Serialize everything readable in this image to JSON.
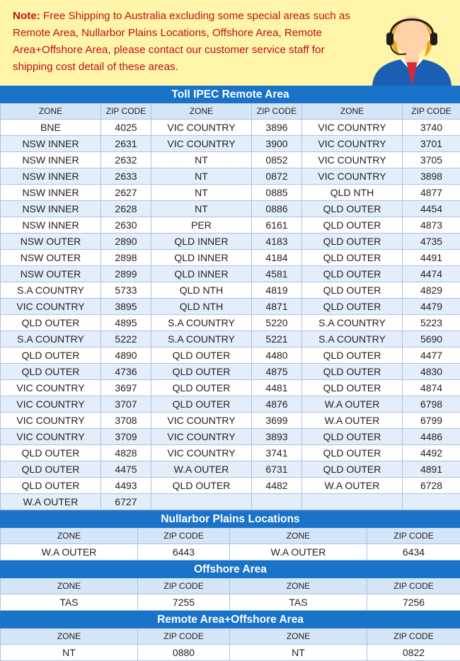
{
  "note": {
    "label": "Note:",
    "text": " Free Shipping to Australia excluding some special areas such as Remote Area, Nullarbor Plains Locations, Offshore Area, Remote Area+Offshore Area, please contact our customer service staff for shipping cost detail of these areas.",
    "agent_icon": "customer-service-agent-icon"
  },
  "colors": {
    "title_bg": "#1873c9",
    "header_bg": "#d4e5f7",
    "alt_row": "#e3eefa",
    "note_bg": "#fff5a8",
    "note_text": "#c00f14"
  },
  "toll": {
    "title": "Toll IPEC Remote Area",
    "headers": [
      "ZONE",
      "ZIP CODE",
      "ZONE",
      "ZIP CODE",
      "ZONE",
      "ZIP CODE"
    ],
    "rows": [
      [
        "BNE",
        "4025",
        "VIC COUNTRY",
        "3896",
        "VIC COUNTRY",
        "3740"
      ],
      [
        "NSW INNER",
        "2631",
        "VIC COUNTRY",
        "3900",
        "VIC COUNTRY",
        "3701"
      ],
      [
        "NSW INNER",
        "2632",
        "NT",
        "0852",
        "VIC COUNTRY",
        "3705"
      ],
      [
        "NSW INNER",
        "2633",
        "NT",
        "0872",
        "VIC COUNTRY",
        "3898"
      ],
      [
        "NSW INNER",
        "2627",
        "NT",
        "0885",
        "QLD NTH",
        "4877"
      ],
      [
        "NSW INNER",
        "2628",
        "NT",
        "0886",
        "QLD OUTER",
        "4454"
      ],
      [
        "NSW INNER",
        "2630",
        "PER",
        "6161",
        "QLD OUTER",
        "4873"
      ],
      [
        "NSW OUTER",
        "2890",
        "QLD INNER",
        "4183",
        "QLD OUTER",
        "4735"
      ],
      [
        "NSW OUTER",
        "2898",
        "QLD INNER",
        "4184",
        "QLD OUTER",
        "4491"
      ],
      [
        "NSW OUTER",
        "2899",
        "QLD INNER",
        "4581",
        "QLD OUTER",
        "4474"
      ],
      [
        "S.A COUNTRY",
        "5733",
        "QLD NTH",
        "4819",
        "QLD OUTER",
        "4829"
      ],
      [
        "VIC COUNTRY",
        "3895",
        "QLD NTH",
        "4871",
        "QLD OUTER",
        "4479"
      ],
      [
        "QLD OUTER",
        "4895",
        "S.A COUNTRY",
        "5220",
        "S.A COUNTRY",
        "5223"
      ],
      [
        "S.A COUNTRY",
        "5222",
        "S.A COUNTRY",
        "5221",
        "S.A COUNTRY",
        "5690"
      ],
      [
        "QLD OUTER",
        "4890",
        "QLD OUTER",
        "4480",
        "QLD OUTER",
        "4477"
      ],
      [
        "QLD OUTER",
        "4736",
        "QLD OUTER",
        "4875",
        "QLD OUTER",
        "4830"
      ],
      [
        "VIC COUNTRY",
        "3697",
        "QLD OUTER",
        "4481",
        "QLD OUTER",
        "4874"
      ],
      [
        "VIC COUNTRY",
        "3707",
        "QLD OUTER",
        "4876",
        "W.A OUTER",
        "6798"
      ],
      [
        "VIC COUNTRY",
        "3708",
        "VIC COUNTRY",
        "3699",
        "W.A OUTER",
        "6799"
      ],
      [
        "VIC COUNTRY",
        "3709",
        "VIC COUNTRY",
        "3893",
        "QLD OUTER",
        "4486"
      ],
      [
        "QLD OUTER",
        "4828",
        "VIC COUNTRY",
        "3741",
        "QLD OUTER",
        "4492"
      ],
      [
        "QLD OUTER",
        "4475",
        "W.A OUTER",
        "6731",
        "QLD OUTER",
        "4891"
      ],
      [
        "QLD OUTER",
        "4493",
        "QLD OUTER",
        "4482",
        "W.A OUTER",
        "6728"
      ],
      [
        "W.A OUTER",
        "6727",
        "",
        "",
        "",
        ""
      ]
    ]
  },
  "nullarbor": {
    "title": "Nullarbor Plains Locations",
    "headers": [
      "ZONE",
      "ZIP CODE",
      "ZONE",
      "ZIP CODE"
    ],
    "rows": [
      [
        "W.A OUTER",
        "6443",
        "W.A OUTER",
        "6434"
      ]
    ]
  },
  "offshore": {
    "title": "Offshore Area",
    "headers": [
      "ZONE",
      "ZIP CODE",
      "ZONE",
      "ZIP CODE"
    ],
    "rows": [
      [
        "TAS",
        "7255",
        "TAS",
        "7256"
      ]
    ]
  },
  "remote_offshore": {
    "title": "Remote Area+Offshore Area",
    "headers": [
      "ZONE",
      "ZIP CODE",
      "ZONE",
      "ZIP CODE"
    ],
    "rows": [
      [
        "NT",
        "0880",
        "NT",
        "0822"
      ]
    ]
  }
}
